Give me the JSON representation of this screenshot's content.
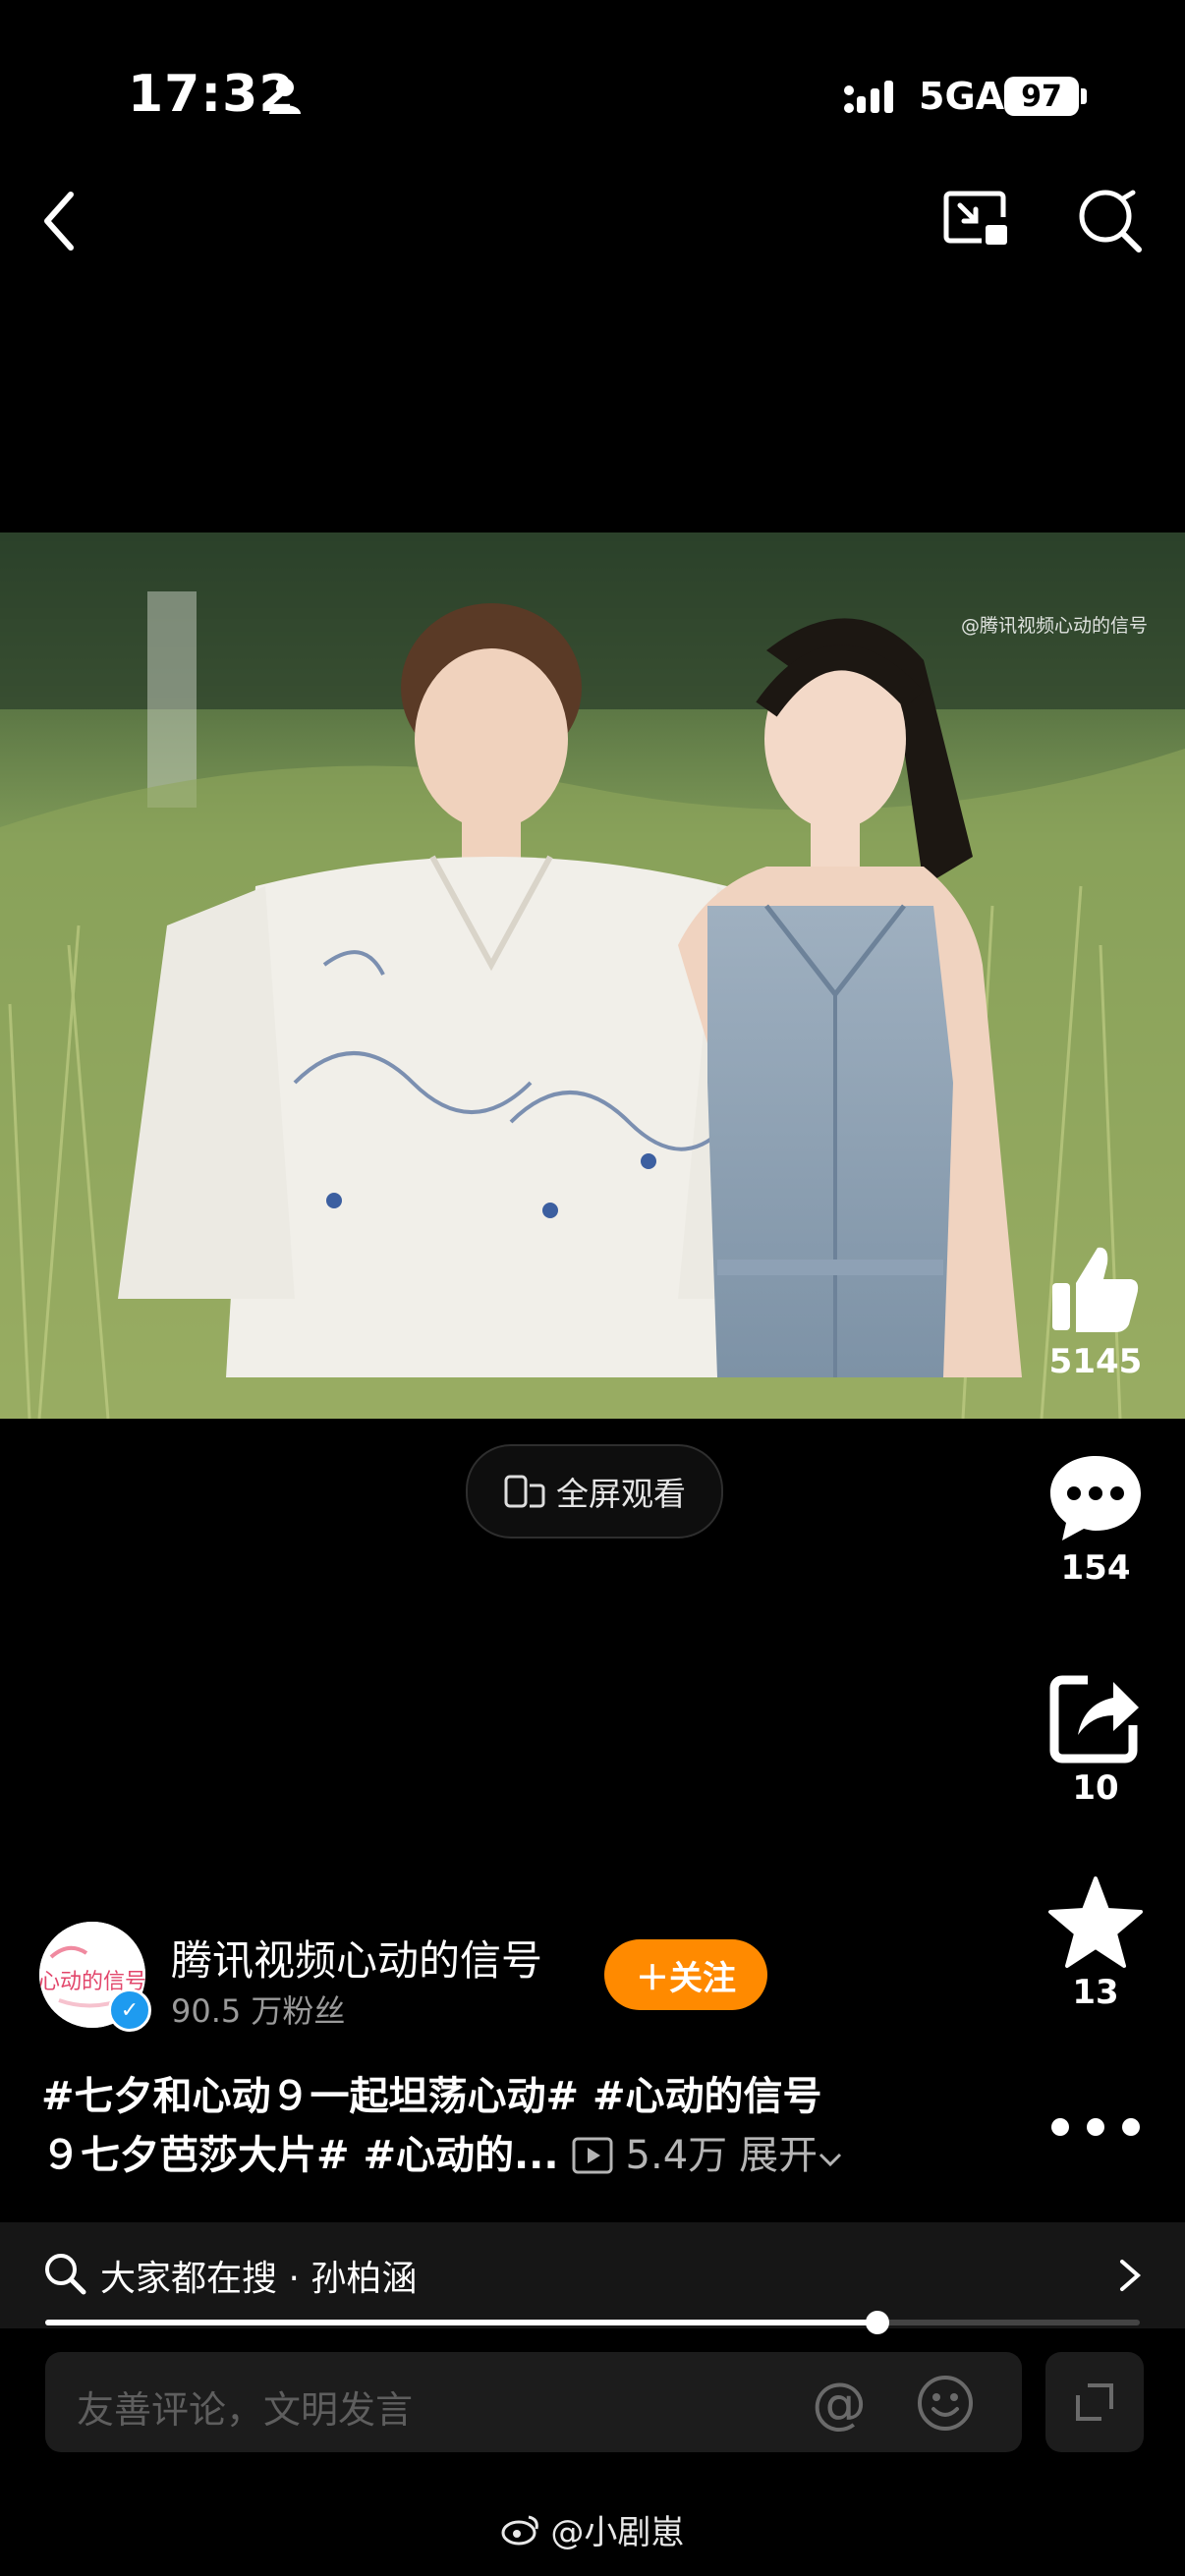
{
  "status": {
    "time": "17:32",
    "network": "5GA",
    "battery": "97"
  },
  "video": {
    "watermark": "@腾讯视频心动的信号",
    "fullscreen_label": "全屏观看"
  },
  "actions": {
    "likes": "5145",
    "comments": "154",
    "shares": "10",
    "favorites": "13"
  },
  "author": {
    "name": "腾讯视频心动的信号",
    "fans": "90.5 万粉丝",
    "follow_label": "＋关注",
    "avatar_text": "心动的信号"
  },
  "caption": {
    "line1": "#七夕和心动９一起坦荡心动# #心动的信号",
    "line2": "９七夕芭莎大片# #心动的...",
    "plays": "5.4万",
    "expand": "展开"
  },
  "search": {
    "text": "大家都在搜 · 孙柏涵"
  },
  "progress": {
    "fraction": 0.76
  },
  "comment": {
    "placeholder": "友善评论，文明发言",
    "at": "@"
  },
  "footer": {
    "watermark": "@小剧崽"
  },
  "colors": {
    "accent": "#ff8a00",
    "verified": "#1e9bf0",
    "background": "#000000"
  }
}
